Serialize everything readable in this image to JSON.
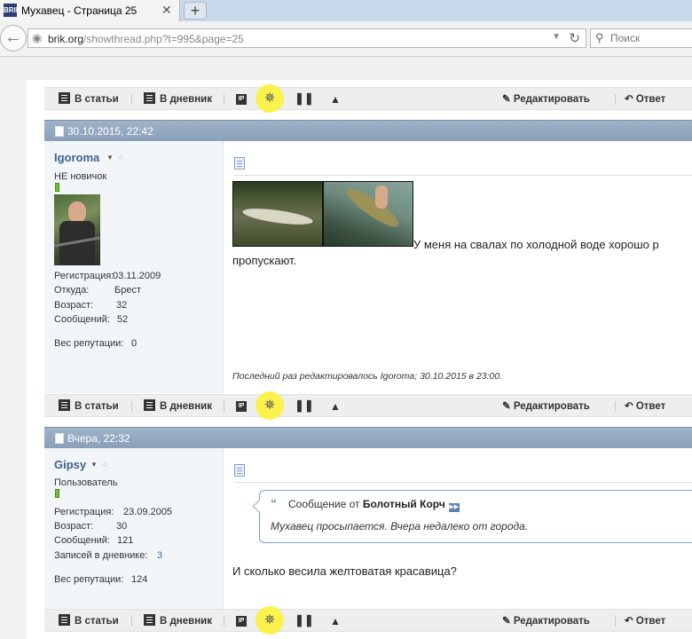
{
  "browser": {
    "tab_title": "Мухавец - Страница 25",
    "favicon_text": "BRIK",
    "close_glyph": "✕",
    "new_tab_glyph": "+",
    "url_host": "brik.org",
    "url_rest": "/showthread.php?t=995&page=25",
    "search_placeholder": "Поиск"
  },
  "post_actions": {
    "articles": "В статьи",
    "diary": "В дневник",
    "ip": "IP",
    "edit": "Редактировать",
    "reply": "Ответ"
  },
  "posts": [
    {
      "date": "30.10.2015, 22:42",
      "username": "Igoroma",
      "user_title": "НЕ новичок",
      "stats": [
        {
          "label": "Регистрация:",
          "value": "03.11.2009"
        },
        {
          "label": "Откуда:",
          "value": "Брест"
        },
        {
          "label": "Возраст:",
          "value": "32"
        },
        {
          "label": "Сообщений:",
          "value": "52"
        }
      ],
      "reputation_label": "Вес репутации:",
      "reputation": "0",
      "text_line1": "У меня на свалах по холодной воде хорошо р",
      "text_line2": "пропускают.",
      "edited_note": "Последний раз редактировалось Igoroma; 30.10.2015 в 23:00."
    },
    {
      "date": "Вчера, 22:32",
      "username": "Gipsy",
      "user_title": "Пользователь",
      "stats": [
        {
          "label": "Регистрация:",
          "value": "23.09.2005"
        },
        {
          "label": "Возраст:",
          "value": "30"
        },
        {
          "label": "Сообщений:",
          "value": "121"
        },
        {
          "label": "Записей в дневнике:",
          "value": "3"
        }
      ],
      "reputation_label": "Вес репутации:",
      "reputation": "124",
      "quote_prefix": "Сообщение от",
      "quote_author": "Болотный Корч",
      "quote_text": "Мухавец просыпается. Вчера недалеко от города.",
      "text": "И сколько весила желтоватая красавица?"
    }
  ],
  "colors": {
    "post_header": "#8aa0b8",
    "username": "#40618c",
    "star_highlight": "#fbf24e",
    "reputation_green": "#6fbf2e"
  }
}
